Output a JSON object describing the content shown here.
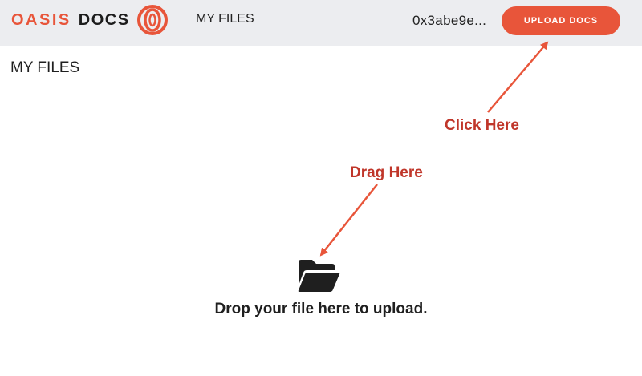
{
  "header": {
    "logo": {
      "word1": "OASIS",
      "word2": "DOCS",
      "mark_icon": "oasis-ring-logo"
    },
    "nav_my_files": "MY FILES",
    "account": "0x3abe9e...",
    "upload_button": "UPLOAD DOCS"
  },
  "main": {
    "title": "MY FILES",
    "drop_zone": {
      "icon": "folder-open-icon",
      "text": "Drop your file here to upload."
    }
  },
  "annotations": {
    "click_here": "Click Here",
    "drag_here": "Drag Here"
  },
  "colors": {
    "accent": "#e8553a",
    "header_bg": "#ecedf0",
    "annotation": "#c0362a"
  }
}
